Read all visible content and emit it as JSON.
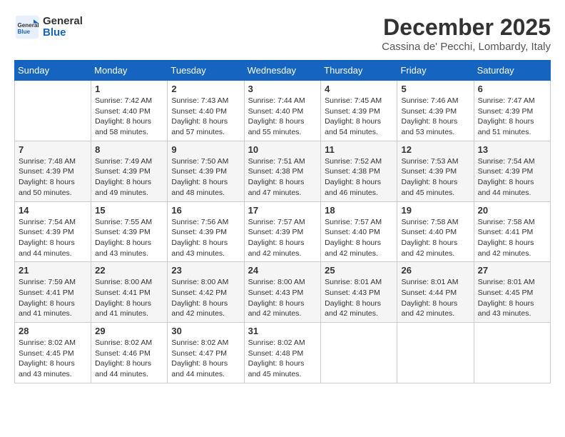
{
  "header": {
    "logo_general": "General",
    "logo_blue": "Blue",
    "month_title": "December 2025",
    "location": "Cassina de' Pecchi, Lombardy, Italy"
  },
  "calendar": {
    "days_of_week": [
      "Sunday",
      "Monday",
      "Tuesday",
      "Wednesday",
      "Thursday",
      "Friday",
      "Saturday"
    ],
    "weeks": [
      [
        {
          "day": "",
          "sunrise": "",
          "sunset": "",
          "daylight": ""
        },
        {
          "day": "1",
          "sunrise": "Sunrise: 7:42 AM",
          "sunset": "Sunset: 4:40 PM",
          "daylight": "Daylight: 8 hours and 58 minutes."
        },
        {
          "day": "2",
          "sunrise": "Sunrise: 7:43 AM",
          "sunset": "Sunset: 4:40 PM",
          "daylight": "Daylight: 8 hours and 57 minutes."
        },
        {
          "day": "3",
          "sunrise": "Sunrise: 7:44 AM",
          "sunset": "Sunset: 4:40 PM",
          "daylight": "Daylight: 8 hours and 55 minutes."
        },
        {
          "day": "4",
          "sunrise": "Sunrise: 7:45 AM",
          "sunset": "Sunset: 4:39 PM",
          "daylight": "Daylight: 8 hours and 54 minutes."
        },
        {
          "day": "5",
          "sunrise": "Sunrise: 7:46 AM",
          "sunset": "Sunset: 4:39 PM",
          "daylight": "Daylight: 8 hours and 53 minutes."
        },
        {
          "day": "6",
          "sunrise": "Sunrise: 7:47 AM",
          "sunset": "Sunset: 4:39 PM",
          "daylight": "Daylight: 8 hours and 51 minutes."
        }
      ],
      [
        {
          "day": "7",
          "sunrise": "Sunrise: 7:48 AM",
          "sunset": "Sunset: 4:39 PM",
          "daylight": "Daylight: 8 hours and 50 minutes."
        },
        {
          "day": "8",
          "sunrise": "Sunrise: 7:49 AM",
          "sunset": "Sunset: 4:39 PM",
          "daylight": "Daylight: 8 hours and 49 minutes."
        },
        {
          "day": "9",
          "sunrise": "Sunrise: 7:50 AM",
          "sunset": "Sunset: 4:39 PM",
          "daylight": "Daylight: 8 hours and 48 minutes."
        },
        {
          "day": "10",
          "sunrise": "Sunrise: 7:51 AM",
          "sunset": "Sunset: 4:38 PM",
          "daylight": "Daylight: 8 hours and 47 minutes."
        },
        {
          "day": "11",
          "sunrise": "Sunrise: 7:52 AM",
          "sunset": "Sunset: 4:38 PM",
          "daylight": "Daylight: 8 hours and 46 minutes."
        },
        {
          "day": "12",
          "sunrise": "Sunrise: 7:53 AM",
          "sunset": "Sunset: 4:39 PM",
          "daylight": "Daylight: 8 hours and 45 minutes."
        },
        {
          "day": "13",
          "sunrise": "Sunrise: 7:54 AM",
          "sunset": "Sunset: 4:39 PM",
          "daylight": "Daylight: 8 hours and 44 minutes."
        }
      ],
      [
        {
          "day": "14",
          "sunrise": "Sunrise: 7:54 AM",
          "sunset": "Sunset: 4:39 PM",
          "daylight": "Daylight: 8 hours and 44 minutes."
        },
        {
          "day": "15",
          "sunrise": "Sunrise: 7:55 AM",
          "sunset": "Sunset: 4:39 PM",
          "daylight": "Daylight: 8 hours and 43 minutes."
        },
        {
          "day": "16",
          "sunrise": "Sunrise: 7:56 AM",
          "sunset": "Sunset: 4:39 PM",
          "daylight": "Daylight: 8 hours and 43 minutes."
        },
        {
          "day": "17",
          "sunrise": "Sunrise: 7:57 AM",
          "sunset": "Sunset: 4:39 PM",
          "daylight": "Daylight: 8 hours and 42 minutes."
        },
        {
          "day": "18",
          "sunrise": "Sunrise: 7:57 AM",
          "sunset": "Sunset: 4:40 PM",
          "daylight": "Daylight: 8 hours and 42 minutes."
        },
        {
          "day": "19",
          "sunrise": "Sunrise: 7:58 AM",
          "sunset": "Sunset: 4:40 PM",
          "daylight": "Daylight: 8 hours and 42 minutes."
        },
        {
          "day": "20",
          "sunrise": "Sunrise: 7:58 AM",
          "sunset": "Sunset: 4:41 PM",
          "daylight": "Daylight: 8 hours and 42 minutes."
        }
      ],
      [
        {
          "day": "21",
          "sunrise": "Sunrise: 7:59 AM",
          "sunset": "Sunset: 4:41 PM",
          "daylight": "Daylight: 8 hours and 41 minutes."
        },
        {
          "day": "22",
          "sunrise": "Sunrise: 8:00 AM",
          "sunset": "Sunset: 4:41 PM",
          "daylight": "Daylight: 8 hours and 41 minutes."
        },
        {
          "day": "23",
          "sunrise": "Sunrise: 8:00 AM",
          "sunset": "Sunset: 4:42 PM",
          "daylight": "Daylight: 8 hours and 42 minutes."
        },
        {
          "day": "24",
          "sunrise": "Sunrise: 8:00 AM",
          "sunset": "Sunset: 4:43 PM",
          "daylight": "Daylight: 8 hours and 42 minutes."
        },
        {
          "day": "25",
          "sunrise": "Sunrise: 8:01 AM",
          "sunset": "Sunset: 4:43 PM",
          "daylight": "Daylight: 8 hours and 42 minutes."
        },
        {
          "day": "26",
          "sunrise": "Sunrise: 8:01 AM",
          "sunset": "Sunset: 4:44 PM",
          "daylight": "Daylight: 8 hours and 42 minutes."
        },
        {
          "day": "27",
          "sunrise": "Sunrise: 8:01 AM",
          "sunset": "Sunset: 4:45 PM",
          "daylight": "Daylight: 8 hours and 43 minutes."
        }
      ],
      [
        {
          "day": "28",
          "sunrise": "Sunrise: 8:02 AM",
          "sunset": "Sunset: 4:45 PM",
          "daylight": "Daylight: 8 hours and 43 minutes."
        },
        {
          "day": "29",
          "sunrise": "Sunrise: 8:02 AM",
          "sunset": "Sunset: 4:46 PM",
          "daylight": "Daylight: 8 hours and 44 minutes."
        },
        {
          "day": "30",
          "sunrise": "Sunrise: 8:02 AM",
          "sunset": "Sunset: 4:47 PM",
          "daylight": "Daylight: 8 hours and 44 minutes."
        },
        {
          "day": "31",
          "sunrise": "Sunrise: 8:02 AM",
          "sunset": "Sunset: 4:48 PM",
          "daylight": "Daylight: 8 hours and 45 minutes."
        },
        {
          "day": "",
          "sunrise": "",
          "sunset": "",
          "daylight": ""
        },
        {
          "day": "",
          "sunrise": "",
          "sunset": "",
          "daylight": ""
        },
        {
          "day": "",
          "sunrise": "",
          "sunset": "",
          "daylight": ""
        }
      ]
    ]
  }
}
